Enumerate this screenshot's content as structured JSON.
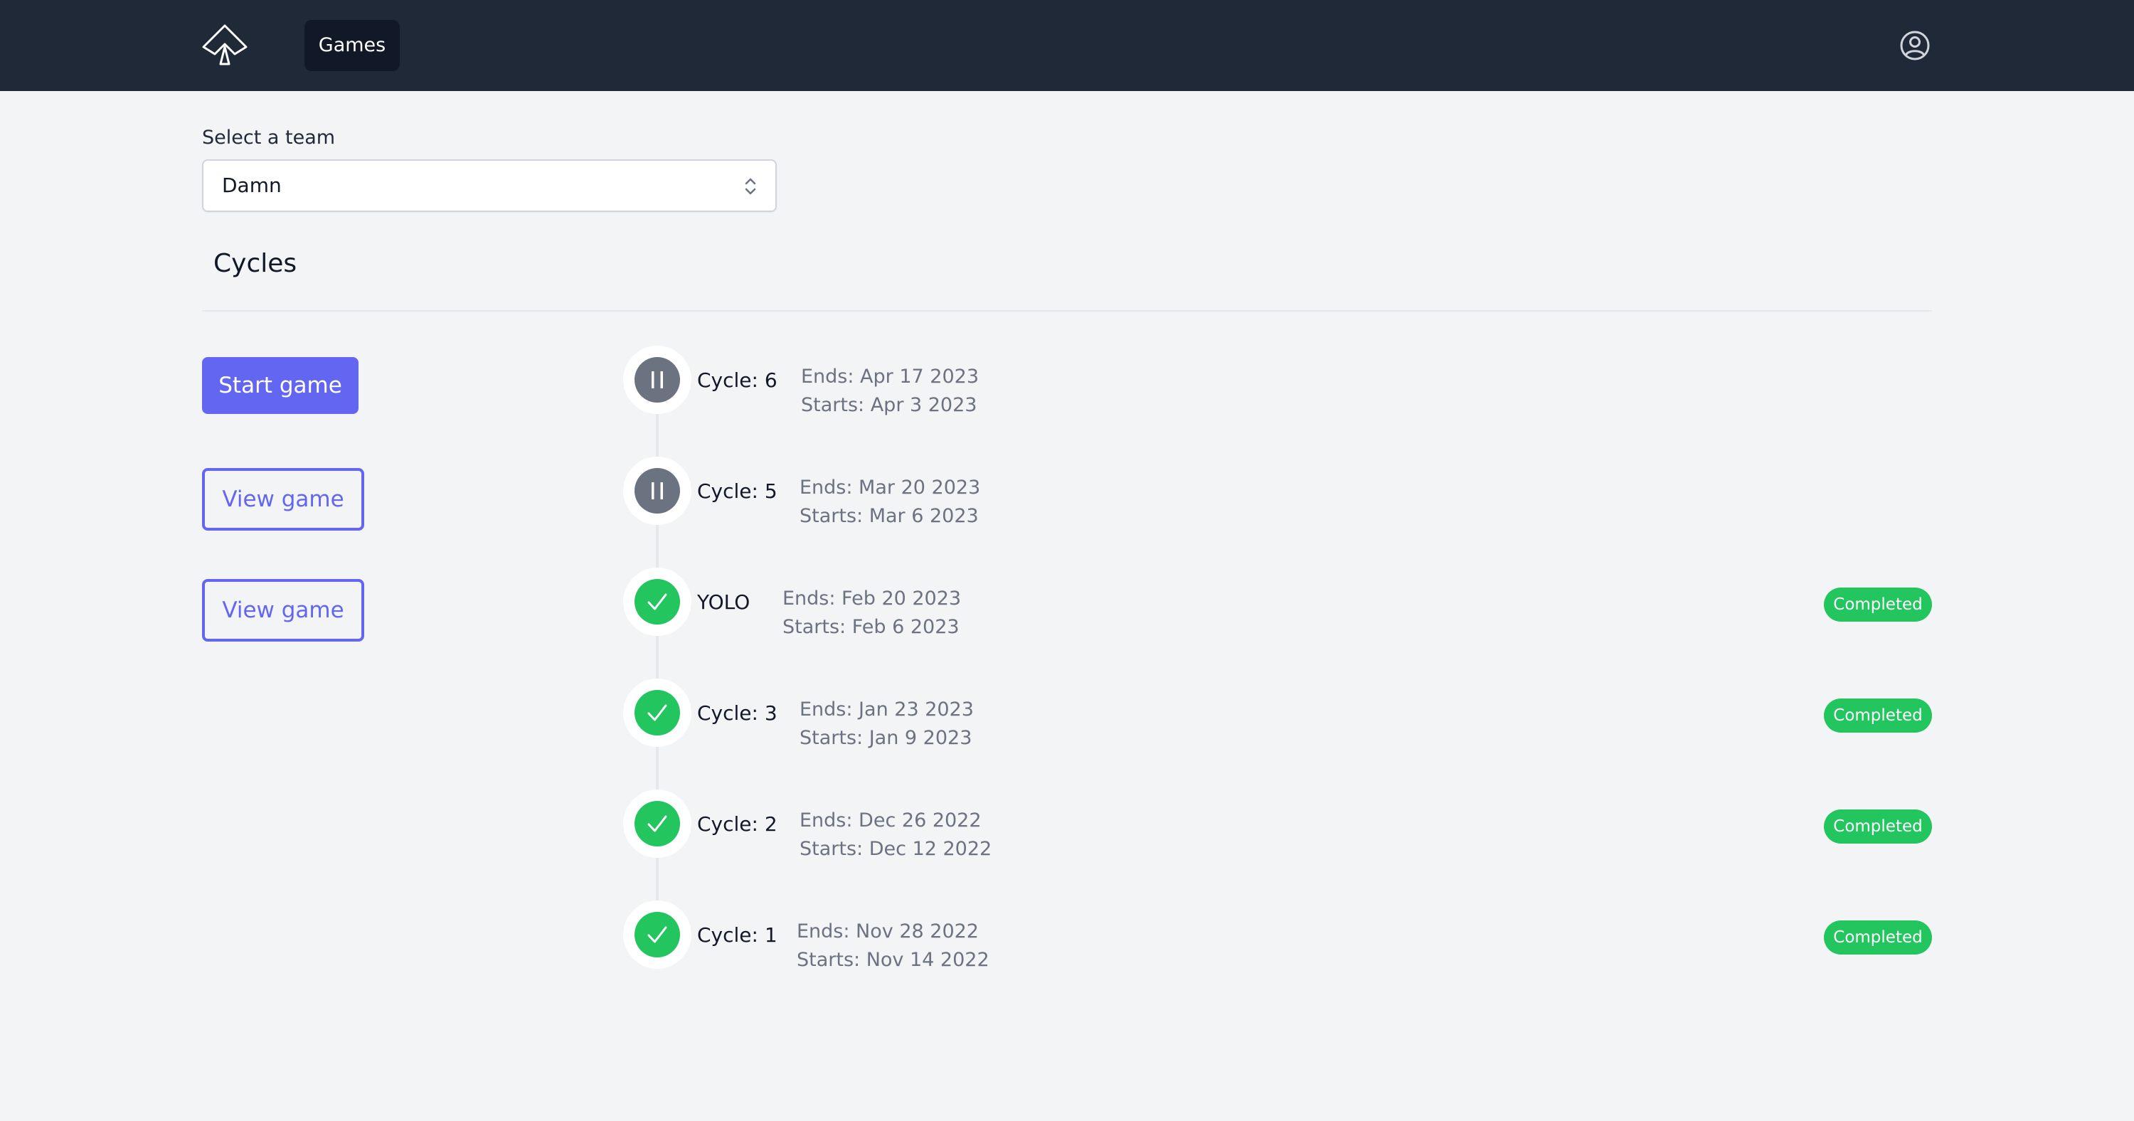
{
  "header": {
    "nav": {
      "games_label": "Games"
    },
    "icons": {
      "logo": "spade-logo-icon",
      "user": "user-circle-icon"
    }
  },
  "team_select": {
    "label": "Select a team",
    "value": "Damn"
  },
  "section": {
    "title": "Cycles"
  },
  "actions": {
    "start_label": "Start game",
    "view_label_1": "View game",
    "view_label_2": "View game"
  },
  "cycles": [
    {
      "name": "Cycle: 6",
      "ends": "Ends: Apr 17 2023",
      "starts": "Starts: Apr 3 2023",
      "status_icon": "pause-icon",
      "badge": ""
    },
    {
      "name": "Cycle: 5",
      "ends": "Ends: Mar 20 2023",
      "starts": "Starts: Mar 6 2023",
      "status_icon": "pause-icon",
      "badge": ""
    },
    {
      "name": "YOLO",
      "ends": "Ends: Feb 20 2023",
      "starts": "Starts: Feb 6 2023",
      "status_icon": "check-icon",
      "badge": "Completed"
    },
    {
      "name": "Cycle: 3",
      "ends": "Ends: Jan 23 2023",
      "starts": "Starts: Jan 9 2023",
      "status_icon": "check-icon",
      "badge": "Completed"
    },
    {
      "name": "Cycle: 2",
      "ends": "Ends: Dec 26 2022",
      "starts": "Starts: Dec 12 2022",
      "status_icon": "check-icon",
      "badge": "Completed"
    },
    {
      "name": "Cycle: 1",
      "ends": "Ends: Nov 28 2022",
      "starts": "Starts: Nov 14 2022",
      "status_icon": "check-icon",
      "badge": "Completed"
    }
  ],
  "colors": {
    "header_bg": "#1f2937",
    "page_bg": "#f3f4f6",
    "primary": "#6366f1",
    "paused": "#6b7280",
    "completed": "#22c55e"
  }
}
